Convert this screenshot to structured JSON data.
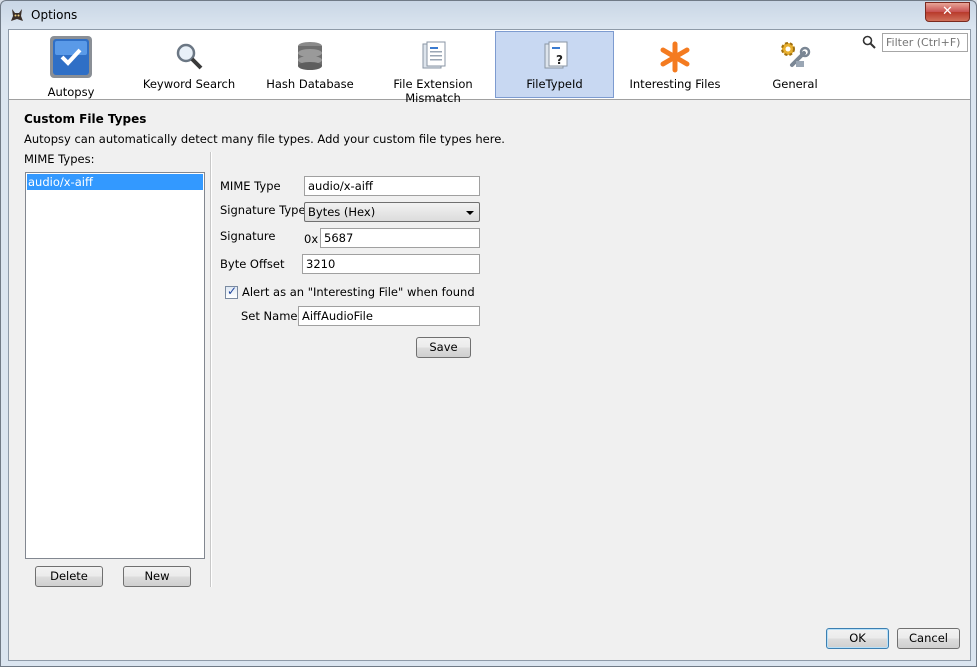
{
  "window": {
    "title": "Options"
  },
  "toolbar": {
    "tabs": [
      {
        "label": "Autopsy",
        "icon": "autopsy-checkbox-icon"
      },
      {
        "label": "Keyword Search",
        "icon": "magnifier-icon"
      },
      {
        "label": "Hash Database",
        "icon": "database-icon"
      },
      {
        "label": "File Extension Mismatch",
        "icon": "document-icon"
      },
      {
        "label": "FileTypeId",
        "icon": "document-question-icon"
      },
      {
        "label": "Interesting Files",
        "icon": "asterisk-icon"
      },
      {
        "label": "General",
        "icon": "gears-icon"
      }
    ],
    "selected_tab": "FileTypeId",
    "filter_placeholder": "Filter (Ctrl+F)"
  },
  "panel": {
    "heading": "Custom File Types",
    "description": "Autopsy can automatically detect many file types. Add your custom file types here.",
    "mime_types_label": "MIME Types:",
    "mime_list": [
      "audio/x-aiff"
    ],
    "delete_label": "Delete",
    "new_label": "New"
  },
  "form": {
    "mime_type_label": "MIME Type",
    "mime_type_value": "audio/x-aiff",
    "signature_type_label": "Signature Type",
    "signature_type_value": "Bytes (Hex)",
    "signature_label": "Signature",
    "signature_prefix": "0x",
    "signature_value": "5687",
    "byte_offset_label": "Byte Offset",
    "byte_offset_value": "3210",
    "alert_label": "Alert as an \"Interesting File\" when found",
    "alert_checked": true,
    "set_name_label": "Set Name",
    "set_name_value": "AiffAudioFile",
    "save_label": "Save"
  },
  "footer": {
    "ok_label": "OK",
    "cancel_label": "Cancel"
  },
  "colors": {
    "selection": "#3399ff",
    "selected_tab": "#c8d8f2",
    "accent_orange": "#f47b20"
  }
}
